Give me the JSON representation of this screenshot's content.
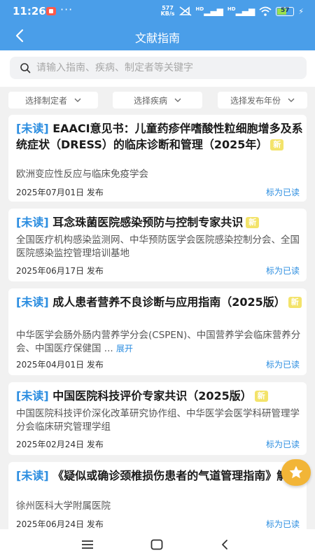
{
  "status_bar": {
    "time": "11:26",
    "dots": "···",
    "net_speed_value": "577",
    "net_speed_unit": "KB/s",
    "signal1": "HD",
    "signal2": "HD",
    "battery": "57",
    "battery_level": 0.57
  },
  "header": {
    "title": "文献指南"
  },
  "search": {
    "placeholder": "请输入指南、疾病、制定者等关键字"
  },
  "filters": [
    {
      "label": "选择制定者"
    },
    {
      "label": "选择疾病"
    },
    {
      "label": "选择发布年份"
    }
  ],
  "labels": {
    "unread": "[未读]",
    "new": "新",
    "mark_read": "标为已读",
    "expand": "展开",
    "published_suffix": "发布"
  },
  "guidelines": [
    {
      "title": "EAACI意见书：儿童药疹伴嗜酸性粒细胞增多及系统症状（DRESS）的临床诊断和管理（2025年）",
      "authors": "欧洲变应性反应与临床免疫学会",
      "date": "2025年07月01日"
    },
    {
      "title": "耳念珠菌医院感染预防与控制专家共识",
      "authors": "全国医疗机构感染监测网、中华预防医学会医院感染控制分会、全国医院感染监控管理培训基地",
      "date": "2025年06月17日"
    },
    {
      "title": "成人患者营养不良诊断与应用指南（2025版）",
      "authors": "中华医学会肠外肠内营养学分会(CSPEN)、中国营养学会临床营养分会、中国医疗保健国 ...",
      "date": "2025年04月01日"
    },
    {
      "title": "中国医院科技评价专家共识（2025版）",
      "authors": "中国医院科技评价深化改革研究协作组、中华医学会医学科研管理学分会临床研究管理学组",
      "date": "2025年02月24日"
    },
    {
      "title": "《疑似或确诊颈椎损伤患者的气道管理指南》解读",
      "authors": "徐州医科大学附属医院",
      "date": "2025年06月24日"
    }
  ]
}
